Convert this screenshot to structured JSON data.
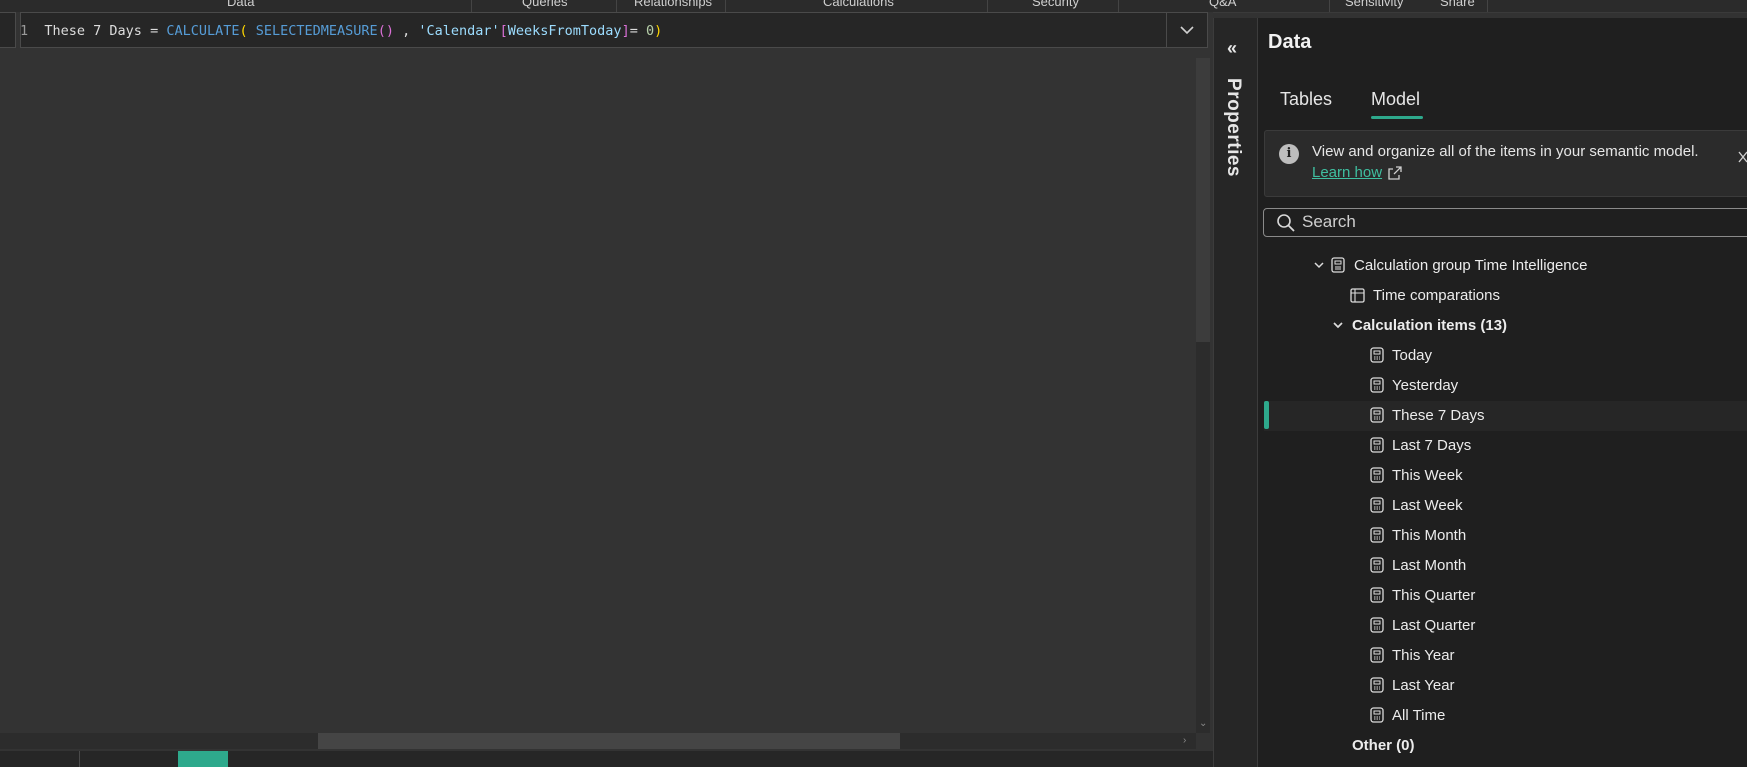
{
  "ribbon": {
    "tabs": [
      "Data",
      "Queries",
      "Relationships",
      "Calculations",
      "Security",
      "Q&A",
      "Sensitivity",
      "Share"
    ]
  },
  "editor": {
    "line_number": "1",
    "code": {
      "name": "These 7 Days",
      "eq": " = ",
      "fn1": "CALCULATE",
      "p1": "( ",
      "fn2": "SELECTEDMEASURE",
      "p2": "()",
      "comma": " , ",
      "table": "'Calendar'",
      "b_open": "[",
      "column": "WeeksFromToday",
      "b_close": "]",
      "op": "= ",
      "num": "0",
      "p3": ")"
    }
  },
  "properties": {
    "label": "Properties"
  },
  "data_pane": {
    "title": "Data",
    "tabs": {
      "tables": "Tables",
      "model": "Model"
    },
    "active_tab": "Model",
    "info": {
      "text": "View and organize all of the items in your semantic model.",
      "link": "Learn how"
    },
    "search": {
      "placeholder": "Search",
      "value": ""
    },
    "tree": {
      "group": "Calculation group Time Intelligence",
      "column": "Time comparations",
      "items_header": "Calculation items (13)",
      "items": [
        "Today",
        "Yesterday",
        "These 7 Days",
        "Last 7 Days",
        "This Week",
        "Last Week",
        "This Month",
        "Last Month",
        "This Quarter",
        "Last Quarter",
        "This Year",
        "Last Year",
        "All Time"
      ],
      "selected": "These 7 Days",
      "other": "Other (0)"
    }
  },
  "colors": {
    "accent": "#2ea98c",
    "background": "#323232",
    "pane": "#1f1f1f"
  }
}
